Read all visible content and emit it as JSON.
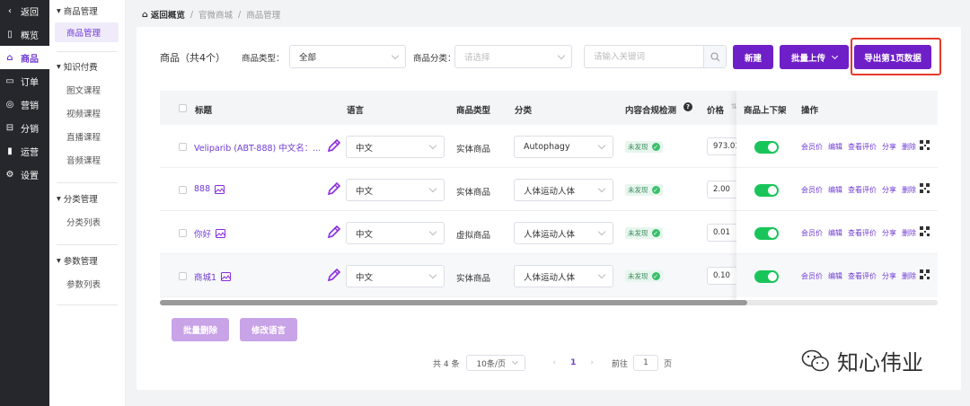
{
  "sidebar": {
    "items": [
      {
        "label": "返回",
        "icon": "chevron-left-icon",
        "glyph": "‹"
      },
      {
        "label": "概览",
        "icon": "overview-icon",
        "glyph": "▯"
      },
      {
        "label": "商品",
        "icon": "shop-icon",
        "glyph": "⌂"
      },
      {
        "label": "订单",
        "icon": "order-icon",
        "glyph": "▭"
      },
      {
        "label": "营销",
        "icon": "marketing-icon",
        "glyph": "◎"
      },
      {
        "label": "分销",
        "icon": "distribution-icon",
        "glyph": "⊟"
      },
      {
        "label": "运营",
        "icon": "operations-icon",
        "glyph": "▮"
      },
      {
        "label": "设置",
        "icon": "settings-icon",
        "glyph": "⚙"
      }
    ]
  },
  "subnav": {
    "groups": [
      {
        "title": "商品管理",
        "items": [
          "商品管理"
        ]
      },
      {
        "title": "知识付费",
        "items": [
          "图文课程",
          "视频课程",
          "直播课程",
          "音频课程"
        ]
      },
      {
        "title": "分类管理",
        "items": [
          "分类列表"
        ]
      },
      {
        "title": "参数管理",
        "items": [
          "参数列表"
        ]
      }
    ]
  },
  "breadcrumb": {
    "home": "返回概览",
    "sep": "/",
    "items": [
      "官微商城",
      "商品管理"
    ]
  },
  "toolbar": {
    "title": "商品（共4个）",
    "type_label": "商品类型：",
    "type_value": "全部",
    "category_label": "商品分类：",
    "category_placeholder": "请选择",
    "search_placeholder": "请输入关键词",
    "new_label": "新建",
    "batch_upload_label": "批量上传",
    "export_label": "导出第1页数据"
  },
  "table": {
    "headers": {
      "title": "标题",
      "language": "语言",
      "type": "商品类型",
      "category": "分类",
      "compliance": "内容合规检测",
      "price": "价格",
      "listing": "商品上下架",
      "actions": "操作"
    },
    "rows": [
      {
        "title": "Veliparib (ABT-888) 中文名：...",
        "language": "中文",
        "type": "实体商品",
        "category": "Autophagy",
        "compliance": "未发现",
        "price": "973.01"
      },
      {
        "title": "888",
        "language": "中文",
        "type": "实体商品",
        "category": "人体运动人体",
        "compliance": "未发现",
        "price": "2.00"
      },
      {
        "title": "你好",
        "language": "中文",
        "type": "虚拟商品",
        "category": "人体运动人体",
        "compliance": "未发现",
        "price": "0.01"
      },
      {
        "title": "商城1",
        "language": "中文",
        "type": "实体商品",
        "category": "人体运动人体",
        "compliance": "未发现",
        "price": "0.10"
      }
    ],
    "ops": [
      "会员价",
      "编辑",
      "查看评价",
      "分享",
      "删除"
    ]
  },
  "footer": {
    "batch_delete": "批量删除",
    "change_language": "修改语言"
  },
  "pager": {
    "total": "共 4 条",
    "page_size": "10条/页",
    "prev": "‹",
    "current": "1",
    "next": "›",
    "goto_label": "前往",
    "goto_value": "1",
    "page_unit": "页"
  },
  "watermark": {
    "text": "知心伟业"
  },
  "colors": {
    "accent": "#6f1fc7",
    "sidebar_bg": "#26272c",
    "toggle_on": "#19c55a",
    "highlight": "#e53a2a"
  }
}
